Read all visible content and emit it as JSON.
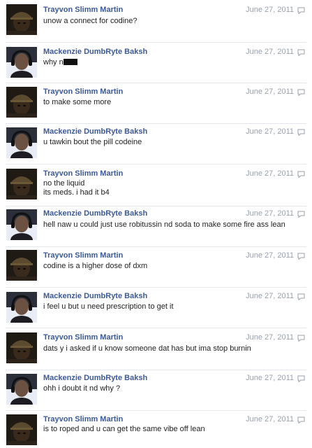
{
  "thread": {
    "messages": [
      {
        "sender": "Trayvon Slimm Martin",
        "date": "June 27, 2011",
        "lines": [
          "unow a connect for codine?"
        ]
      },
      {
        "sender": "Mackenzie DumbRyte Baksh",
        "date": "June 27, 2011",
        "lines": [
          "why n"
        ],
        "redacted": true
      },
      {
        "sender": "Trayvon Slimm Martin",
        "date": "June 27, 2011",
        "lines": [
          "to make some more"
        ]
      },
      {
        "sender": "Mackenzie DumbRyte Baksh",
        "date": "June 27, 2011",
        "lines": [
          "u tawkin bout the pill codeine"
        ]
      },
      {
        "sender": "Trayvon Slimm Martin",
        "date": "June 27, 2011",
        "lines": [
          "no the liquid",
          "its meds. i had it b4"
        ]
      },
      {
        "sender": "Mackenzie DumbRyte Baksh",
        "date": "June 27, 2011",
        "lines": [
          "hell naw u could just use robitussin nd soda to make some fire ass lean"
        ]
      },
      {
        "sender": "Trayvon Slimm Martin",
        "date": "June 27, 2011",
        "lines": [
          "codine is a higher dose of dxm"
        ]
      },
      {
        "sender": "Mackenzie DumbRyte Baksh",
        "date": "June 27, 2011",
        "lines": [
          "i feel u but u need prescription to get it"
        ]
      },
      {
        "sender": "Trayvon Slimm Martin",
        "date": "June 27, 2011",
        "lines": [
          "dats y i asked if u know someone dat has but ima stop burnin"
        ]
      },
      {
        "sender": "Mackenzie DumbRyte Baksh",
        "date": "June 27, 2011",
        "lines": [
          "ohh i doubt it nd why ?"
        ]
      },
      {
        "sender": "Trayvon Slimm Martin",
        "date": "June 27, 2011",
        "lines": [
          "is to roped and u can get the same vibe off lean"
        ]
      }
    ]
  },
  "icons": {
    "avatar_trayvon": "profile-photo-cap",
    "avatar_mackenzie": "profile-photo-headphones",
    "reply": "speech-bubble-icon"
  },
  "colors": {
    "name_link": "#3b5998",
    "date": "#9aa0aa",
    "text": "#222222",
    "separator": "#e3e6ec"
  }
}
